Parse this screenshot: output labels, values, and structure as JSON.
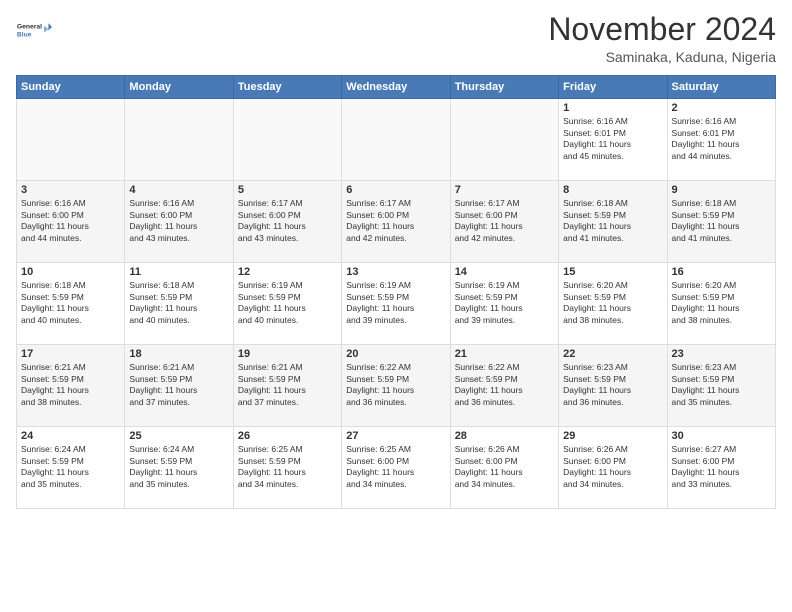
{
  "logo": {
    "line1": "General",
    "line2": "Blue"
  },
  "title": "November 2024",
  "subtitle": "Saminaka, Kaduna, Nigeria",
  "days": [
    "Sunday",
    "Monday",
    "Tuesday",
    "Wednesday",
    "Thursday",
    "Friday",
    "Saturday"
  ],
  "weeks": [
    [
      {
        "day": "",
        "content": ""
      },
      {
        "day": "",
        "content": ""
      },
      {
        "day": "",
        "content": ""
      },
      {
        "day": "",
        "content": ""
      },
      {
        "day": "",
        "content": ""
      },
      {
        "day": "1",
        "content": "Sunrise: 6:16 AM\nSunset: 6:01 PM\nDaylight: 11 hours\nand 45 minutes."
      },
      {
        "day": "2",
        "content": "Sunrise: 6:16 AM\nSunset: 6:01 PM\nDaylight: 11 hours\nand 44 minutes."
      }
    ],
    [
      {
        "day": "3",
        "content": "Sunrise: 6:16 AM\nSunset: 6:00 PM\nDaylight: 11 hours\nand 44 minutes."
      },
      {
        "day": "4",
        "content": "Sunrise: 6:16 AM\nSunset: 6:00 PM\nDaylight: 11 hours\nand 43 minutes."
      },
      {
        "day": "5",
        "content": "Sunrise: 6:17 AM\nSunset: 6:00 PM\nDaylight: 11 hours\nand 43 minutes."
      },
      {
        "day": "6",
        "content": "Sunrise: 6:17 AM\nSunset: 6:00 PM\nDaylight: 11 hours\nand 42 minutes."
      },
      {
        "day": "7",
        "content": "Sunrise: 6:17 AM\nSunset: 6:00 PM\nDaylight: 11 hours\nand 42 minutes."
      },
      {
        "day": "8",
        "content": "Sunrise: 6:18 AM\nSunset: 5:59 PM\nDaylight: 11 hours\nand 41 minutes."
      },
      {
        "day": "9",
        "content": "Sunrise: 6:18 AM\nSunset: 5:59 PM\nDaylight: 11 hours\nand 41 minutes."
      }
    ],
    [
      {
        "day": "10",
        "content": "Sunrise: 6:18 AM\nSunset: 5:59 PM\nDaylight: 11 hours\nand 40 minutes."
      },
      {
        "day": "11",
        "content": "Sunrise: 6:18 AM\nSunset: 5:59 PM\nDaylight: 11 hours\nand 40 minutes."
      },
      {
        "day": "12",
        "content": "Sunrise: 6:19 AM\nSunset: 5:59 PM\nDaylight: 11 hours\nand 40 minutes."
      },
      {
        "day": "13",
        "content": "Sunrise: 6:19 AM\nSunset: 5:59 PM\nDaylight: 11 hours\nand 39 minutes."
      },
      {
        "day": "14",
        "content": "Sunrise: 6:19 AM\nSunset: 5:59 PM\nDaylight: 11 hours\nand 39 minutes."
      },
      {
        "day": "15",
        "content": "Sunrise: 6:20 AM\nSunset: 5:59 PM\nDaylight: 11 hours\nand 38 minutes."
      },
      {
        "day": "16",
        "content": "Sunrise: 6:20 AM\nSunset: 5:59 PM\nDaylight: 11 hours\nand 38 minutes."
      }
    ],
    [
      {
        "day": "17",
        "content": "Sunrise: 6:21 AM\nSunset: 5:59 PM\nDaylight: 11 hours\nand 38 minutes."
      },
      {
        "day": "18",
        "content": "Sunrise: 6:21 AM\nSunset: 5:59 PM\nDaylight: 11 hours\nand 37 minutes."
      },
      {
        "day": "19",
        "content": "Sunrise: 6:21 AM\nSunset: 5:59 PM\nDaylight: 11 hours\nand 37 minutes."
      },
      {
        "day": "20",
        "content": "Sunrise: 6:22 AM\nSunset: 5:59 PM\nDaylight: 11 hours\nand 36 minutes."
      },
      {
        "day": "21",
        "content": "Sunrise: 6:22 AM\nSunset: 5:59 PM\nDaylight: 11 hours\nand 36 minutes."
      },
      {
        "day": "22",
        "content": "Sunrise: 6:23 AM\nSunset: 5:59 PM\nDaylight: 11 hours\nand 36 minutes."
      },
      {
        "day": "23",
        "content": "Sunrise: 6:23 AM\nSunset: 5:59 PM\nDaylight: 11 hours\nand 35 minutes."
      }
    ],
    [
      {
        "day": "24",
        "content": "Sunrise: 6:24 AM\nSunset: 5:59 PM\nDaylight: 11 hours\nand 35 minutes."
      },
      {
        "day": "25",
        "content": "Sunrise: 6:24 AM\nSunset: 5:59 PM\nDaylight: 11 hours\nand 35 minutes."
      },
      {
        "day": "26",
        "content": "Sunrise: 6:25 AM\nSunset: 5:59 PM\nDaylight: 11 hours\nand 34 minutes."
      },
      {
        "day": "27",
        "content": "Sunrise: 6:25 AM\nSunset: 6:00 PM\nDaylight: 11 hours\nand 34 minutes."
      },
      {
        "day": "28",
        "content": "Sunrise: 6:26 AM\nSunset: 6:00 PM\nDaylight: 11 hours\nand 34 minutes."
      },
      {
        "day": "29",
        "content": "Sunrise: 6:26 AM\nSunset: 6:00 PM\nDaylight: 11 hours\nand 34 minutes."
      },
      {
        "day": "30",
        "content": "Sunrise: 6:27 AM\nSunset: 6:00 PM\nDaylight: 11 hours\nand 33 minutes."
      }
    ]
  ]
}
